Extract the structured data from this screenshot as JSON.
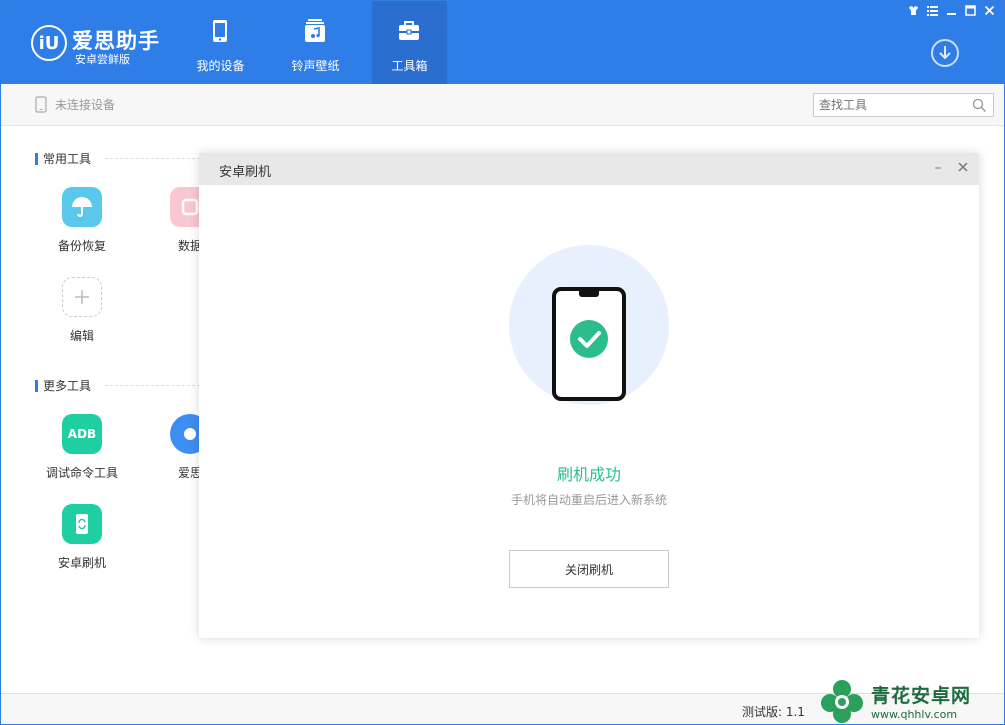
{
  "app": {
    "name": "爱思助手",
    "subtitle": "安卓尝鲜版",
    "logo_text": "iU"
  },
  "nav": {
    "tabs": [
      {
        "label": "我的设备",
        "icon": "phone-icon",
        "active": false
      },
      {
        "label": "铃声壁纸",
        "icon": "music-icon",
        "active": false
      },
      {
        "label": "工具箱",
        "icon": "toolbox-icon",
        "active": true
      }
    ]
  },
  "subbar": {
    "device_status": "未连接设备",
    "search_placeholder": "查找工具"
  },
  "sections": {
    "common": "常用工具",
    "more": "更多工具"
  },
  "tools": {
    "backup": {
      "label": "备份恢复",
      "icon": "umbrella-icon",
      "color": "#5ac8ea"
    },
    "data": {
      "label": "数据",
      "icon": "data-migration-icon",
      "color": "#f7a9b8"
    },
    "edit": {
      "label": "编辑",
      "icon": "plus-icon"
    },
    "adb": {
      "label": "调试命令工具",
      "icon_text": "ADB",
      "color": "#1fcfa2"
    },
    "aisi": {
      "label": "爱思",
      "icon": "aisi-app-icon",
      "color": "#3d8ef0"
    },
    "flash": {
      "label": "安卓刷机",
      "icon": "refresh-phone-icon",
      "color": "#1fcfa2"
    }
  },
  "dialog": {
    "title": "安卓刷机",
    "success_title": "刷机成功",
    "success_message": "手机将自动重启后进入新系统",
    "close_button": "关闭刷机"
  },
  "footer": {
    "version": "测试版: 1.1"
  },
  "watermark": {
    "title": "青花安卓网",
    "url": "www.qhhlv.com"
  },
  "colors": {
    "brand_blue": "#2f7ee8",
    "success_green": "#2bbe8c",
    "tool_green": "#1fcfa2"
  }
}
